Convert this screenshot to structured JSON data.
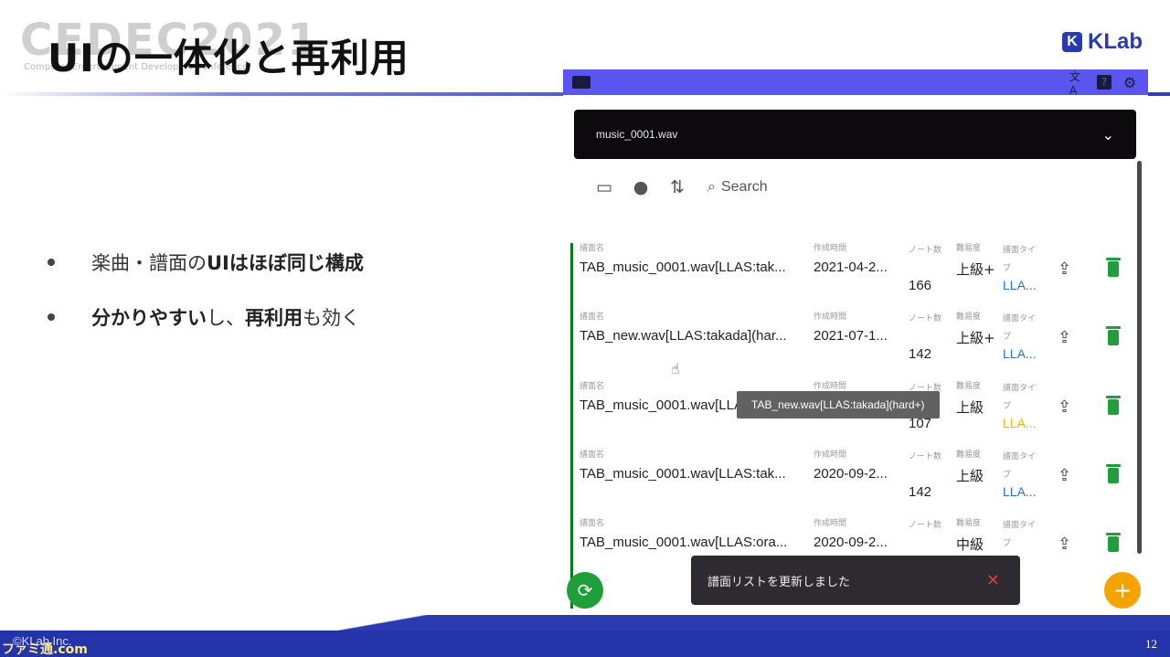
{
  "slide": {
    "event_logo": "CEDEC2021",
    "event_sub": "Computer Entertainment Developers Conference",
    "title": "UIの一体化と再利用",
    "company_logo": "KLab",
    "company_mark": "K",
    "bullets": [
      {
        "pre": "楽曲・譜面の",
        "bold": "UIはほぼ同じ構成",
        "post": ""
      },
      {
        "pre": "",
        "bold": "分かりやすい",
        "post": "し、",
        "bold2": "再利用",
        "post2": "も効く"
      }
    ],
    "copyright": "©KLab Inc.",
    "page_number": "12",
    "watermark": "ファミ通.com"
  },
  "app": {
    "topbar": {
      "translate_icon": "文A",
      "help_icon": "?",
      "settings_icon": "⚙"
    },
    "file_select": {
      "value": "music_0001.wav"
    },
    "tools": {
      "search_label": "Search"
    },
    "column_labels": {
      "name": "譜面名",
      "created": "作成時間",
      "notes": "ノート数",
      "difficulty": "難易度",
      "type": "譜面タイプ"
    },
    "rows": [
      {
        "name": "TAB_music_0001.wav[LLAS:tak...",
        "date": "2021-04-2...",
        "notes": "166",
        "difficulty": "上級+",
        "type": "LLA..."
      },
      {
        "name": "TAB_new.wav[LLAS:takada](har...",
        "date": "2021-07-1...",
        "notes": "142",
        "difficulty": "上級+",
        "type": "LLA..."
      },
      {
        "name": "TAB_music_0001.wav[LLAS:tak...",
        "date": "",
        "notes": "107",
        "difficulty": "上級",
        "type": "LLA..."
      },
      {
        "name": "TAB_music_0001.wav[LLAS:tak...",
        "date": "2020-09-2...",
        "notes": "142",
        "difficulty": "上級",
        "type": "LLA..."
      },
      {
        "name": "TAB_music_0001.wav[LLAS:ora...",
        "date": "2020-09-2...",
        "notes": "",
        "difficulty": "中級",
        "type": ""
      }
    ],
    "row_type_colors": [
      "#2b6fd6",
      "#2b6fd6",
      "#e8b400",
      "#2b6fd6",
      "#e8b400"
    ],
    "tooltip": "TAB_new.wav[LLAS:takada](hard+)",
    "snackbar": {
      "message": "譜面リストを更新しました",
      "close_icon": "✕"
    },
    "fab_refresh_icon": "⟳",
    "fab_add_icon": "+",
    "colors": {
      "topbar": "#5b55f0",
      "accent_green": "#1f9e3a",
      "accent_orange": "#f5a300",
      "dark": "#0d0a0d"
    }
  }
}
